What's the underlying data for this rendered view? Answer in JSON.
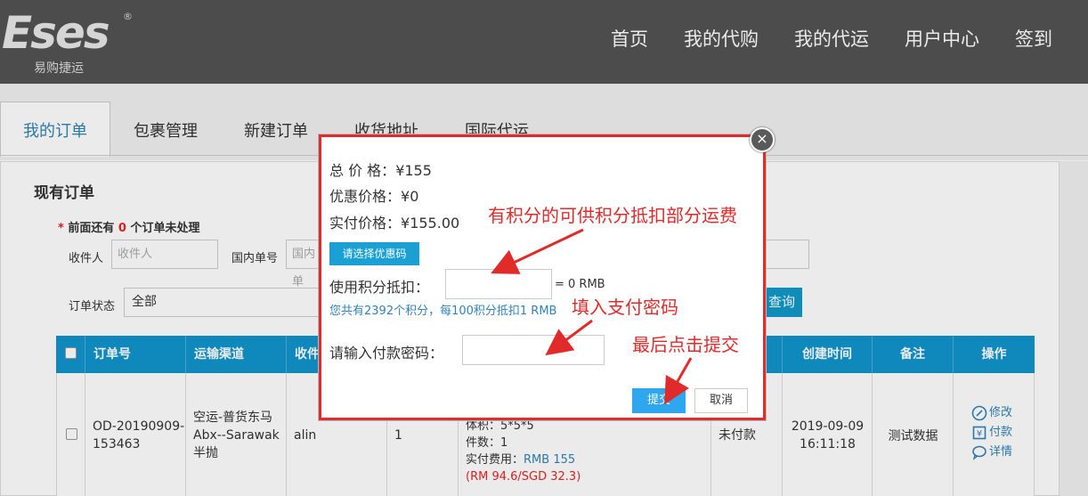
{
  "header": {
    "logo_text": "Eses",
    "logo_registered": "®",
    "logo_subtitle": "易购捷运",
    "nav": [
      "首页",
      "我的代购",
      "我的代运",
      "用户中心",
      "签到"
    ]
  },
  "tabs": [
    "我的订单",
    "包裹管理",
    "新建订单",
    "收货地址",
    "国际代运"
  ],
  "orders": {
    "title": "现有订单",
    "notice_star": "*",
    "notice_prefix": "前面还有",
    "notice_count": "0",
    "notice_suffix": "个订单未处理",
    "filters": {
      "receiver_label": "收件人",
      "receiver_placeholder": "收件人",
      "domestic_label": "国内单号",
      "domestic_placeholder": "国内单",
      "status_label": "订单状态",
      "status_value": "全部",
      "query_label": "查询"
    },
    "columns": [
      "订单号",
      "运输渠道",
      "收件",
      "",
      "",
      "",
      "创建时间",
      "备注",
      "操作"
    ],
    "row": {
      "order_no": [
        "OD-20190909-",
        "153463"
      ],
      "channel": [
        "空运-普货东马",
        "Abx--Sarawak",
        "半抛"
      ],
      "receiver": "alin",
      "qty": "1",
      "details": [
        "体积：5*5*5",
        "件数：1"
      ],
      "paid_label": "实付费用：",
      "paid_value": "RMB 155",
      "paid_other": "(RM 94.6/SGD 32.3)",
      "status": "未付款",
      "created": [
        "2019-09-09",
        "16:11:18"
      ],
      "remark": "测试数据",
      "actions": [
        "修改",
        "付款",
        "详情"
      ]
    }
  },
  "modal": {
    "total_label": "总 价 格：",
    "total_value": "¥155",
    "discount_label": "优惠价格：",
    "discount_value": "¥0",
    "paid_label": "实付价格：",
    "paid_value": "¥155.00",
    "coupon_button": "请选择优惠码",
    "points_label": "使用积分抵扣：",
    "points_value": "",
    "points_rmb": "= 0 RMB",
    "points_tip": "您共有2392个积分，每100积分抵扣1 RMB",
    "password_label": "请输入付款密码：",
    "password_value": "",
    "submit": "提交",
    "cancel": "取消",
    "close": "×"
  },
  "annotations": {
    "points_note": "有积分的可供积分抵扣部分运费",
    "password_note": "填入支付密码",
    "submit_note": "最后点击提交",
    "color": "#e12b2b"
  },
  "colors": {
    "header_bg": "#535353",
    "table_header": "#1195cb",
    "modal_border": "#e32b2b",
    "link": "#2f83b9"
  }
}
